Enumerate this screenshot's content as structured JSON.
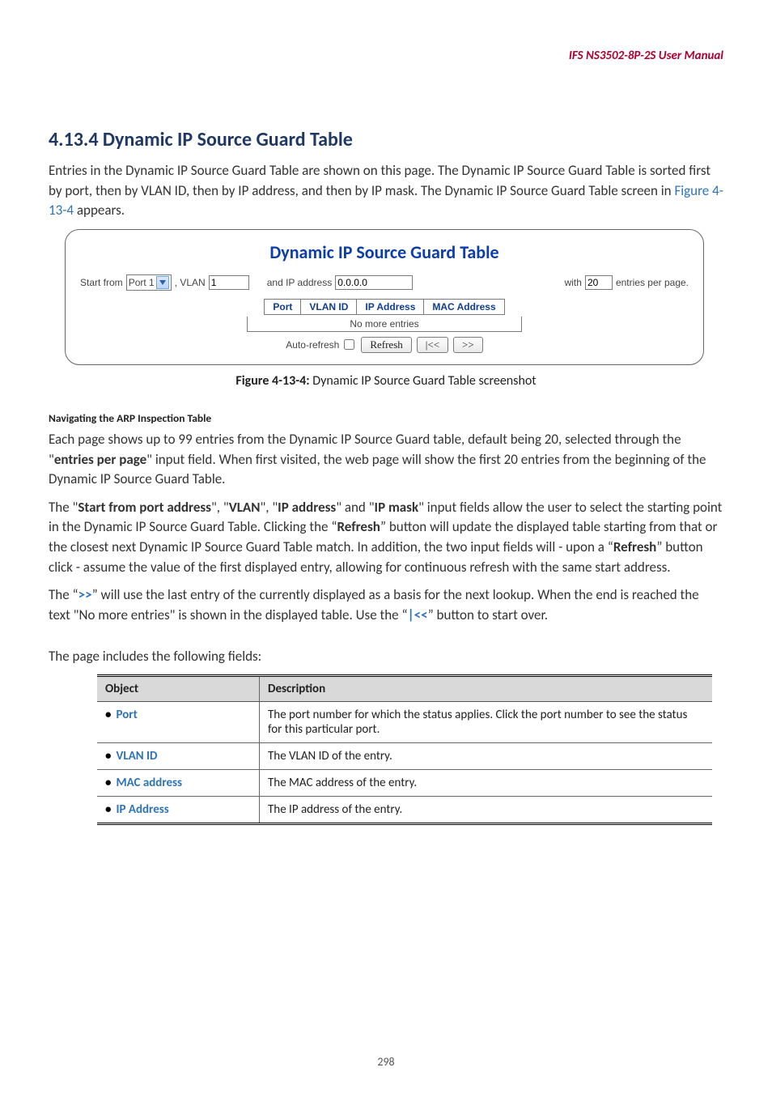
{
  "runhead": "IFS  NS3502-8P-2S   User  Manual",
  "section_title": "4.13.4 Dynamic IP Source Guard Table",
  "intro_a": "Entries in the Dynamic IP Source Guard Table are shown on this page. The Dynamic IP Source Guard Table is sorted first by port, then by VLAN ID, then by IP address, and then by IP mask. The Dynamic IP Source Guard Table screen in ",
  "intro_figref": "Figure 4-13-4",
  "intro_b": " appears.",
  "fig": {
    "title": "Dynamic IP Source Guard Table",
    "start_from_label": "Start from",
    "port_value": "Port 1",
    "vlan_label": ", VLAN",
    "vlan_value": "1",
    "ip_label": "and IP address",
    "ip_value": "0.0.0.0",
    "with_label": "with",
    "with_value": "20",
    "per_page_label": "entries per page.",
    "cols": {
      "port": "Port",
      "vlan": "VLAN ID",
      "ip": "IP Address",
      "mac": "MAC Address"
    },
    "no_entries": "No more entries",
    "auto_refresh": "Auto-refresh",
    "refresh": "Refresh",
    "prev": "|<<",
    "next": ">>"
  },
  "fig_caption_bold": "Figure 4-13-4:",
  "fig_caption_rest": " Dynamic IP Source Guard Table screenshot",
  "nav_head": "Navigating the ARP Inspection Table",
  "p1_a": "Each page shows up to 99 entries from the Dynamic IP Source Guard table, default being 20, selected through the \"",
  "p1_b": "entries per page",
  "p1_c": "\" input field. When first visited, the web page will show the first 20 entries from the beginning of the Dynamic IP Source Guard Table.",
  "p2_a": "The \"",
  "p2_b": "Start from port address",
  "p2_c": "\", \"",
  "p2_d": "VLAN",
  "p2_e": "\", \"",
  "p2_f": "IP address",
  "p2_g": "\" and \"",
  "p2_h": "IP mask",
  "p2_i": "\" input fields allow the user to select the starting point in the Dynamic IP Source Guard Table. Clicking the “",
  "p2_j": "Refresh",
  "p2_k": "” button will update the displayed table starting from that or the closest next Dynamic IP Source Guard Table match. In addition, the two input fields will - upon a “",
  "p2_l": "Refresh",
  "p2_m": "” button click - assume the value of the first displayed entry, allowing for continuous refresh with the same start address.",
  "p3_a": "The “",
  "p3_b": ">>",
  "p3_c": "” will use the last entry of the currently displayed as a basis for the next lookup. When the end is reached the text \"No more entries\" is shown in the displayed table. Use the “",
  "p3_d": "|<<",
  "p3_e": "” button to start over.",
  "fields_intro": "The page includes the following fields:",
  "table": {
    "h_obj": "Object",
    "h_desc": "Description",
    "rows": [
      {
        "obj": "Port",
        "desc": "The port number for which the status applies. Click the port number to see the status for this particular port."
      },
      {
        "obj": "VLAN ID",
        "desc": "The VLAN ID of the entry."
      },
      {
        "obj": "MAC address",
        "desc": "The MAC address of the entry."
      },
      {
        "obj": "IP Address",
        "desc": "The IP address of the entry."
      }
    ]
  },
  "pagenum": "298"
}
